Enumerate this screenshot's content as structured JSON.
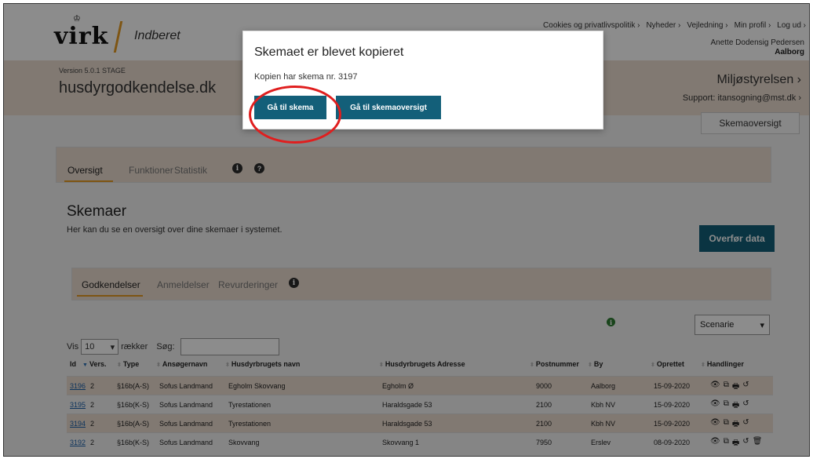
{
  "header": {
    "logo_crown": "♔",
    "logo_text": "virk",
    "logo_sub": "Indberet",
    "top_links": [
      "Cookies og privatlivspolitik ›",
      "Nyheder ›",
      "Vejledning ›",
      "Min profil ›",
      "Log ud ›"
    ],
    "user_name": "Anette Dodensig Pedersen",
    "user_city": "Aalborg",
    "version": "Version 5.0.1 STAGE",
    "site_title": "husdyrgodkendelse.dk",
    "authority": "Miljøstyrelsen ›",
    "support": "Support: itansogning@mst.dk ›",
    "skemaoversigt_button": "Skemaoversigt"
  },
  "tabs_main": {
    "items": [
      "Oversigt",
      "Funktioner",
      "Statistik"
    ],
    "active": "Oversigt"
  },
  "section": {
    "title": "Skemaer",
    "subtitle": "Her kan du se en oversigt over dine skemaer i systemet.",
    "transfer_button": "Overfør data"
  },
  "tabs_sub": {
    "items": [
      "Godkendelser",
      "Anmeldelser",
      "Revurderinger"
    ],
    "active": "Godkendelser"
  },
  "controls": {
    "vis_label": "Vis",
    "vis_value": "10",
    "rows_label": "rækker",
    "search_label": "Søg:",
    "search_value": "",
    "scenarie_value": "Scenarie"
  },
  "table": {
    "headers": [
      "Id",
      "Vers.",
      "Type",
      "Ansøgernavn",
      "Husdyrbrugets navn",
      "Husdyrbrugets Adresse",
      "Postnummer",
      "By",
      "Oprettet",
      "Handlinger"
    ],
    "rows": [
      {
        "id": "3196",
        "vers": "2",
        "type": "§16b(A-S)",
        "applicant": "Sofus Landmand",
        "farm": "Egholm Skovvang",
        "address": "Egholm Ø",
        "zip": "9000",
        "city": "Aalborg",
        "created": "15-09-2020",
        "has_delete": false
      },
      {
        "id": "3195",
        "vers": "2",
        "type": "§16b(K-S)",
        "applicant": "Sofus Landmand",
        "farm": "Tyrestationen",
        "address": "Haraldsgade 53",
        "zip": "2100",
        "city": "Kbh NV",
        "created": "15-09-2020",
        "has_delete": false
      },
      {
        "id": "3194",
        "vers": "2",
        "type": "§16b(A-S)",
        "applicant": "Sofus Landmand",
        "farm": "Tyrestationen",
        "address": "Haraldsgade 53",
        "zip": "2100",
        "city": "Kbh NV",
        "created": "15-09-2020",
        "has_delete": false
      },
      {
        "id": "3192",
        "vers": "2",
        "type": "§16b(K-S)",
        "applicant": "Sofus Landmand",
        "farm": "Skovvang",
        "address": "Skovvang 1",
        "zip": "7950",
        "city": "Erslev",
        "created": "08-09-2020",
        "has_delete": true
      }
    ]
  },
  "modal": {
    "title": "Skemaet er blevet kopieret",
    "text": "Kopien har skema nr. 3197",
    "primary_button": "Gå til skema",
    "secondary_button": "Gå til skemaoversigt"
  },
  "colors": {
    "accent": "#135f79",
    "band": "#ecddd0",
    "underline": "#e69b24",
    "highlight": "#e01e1e"
  }
}
